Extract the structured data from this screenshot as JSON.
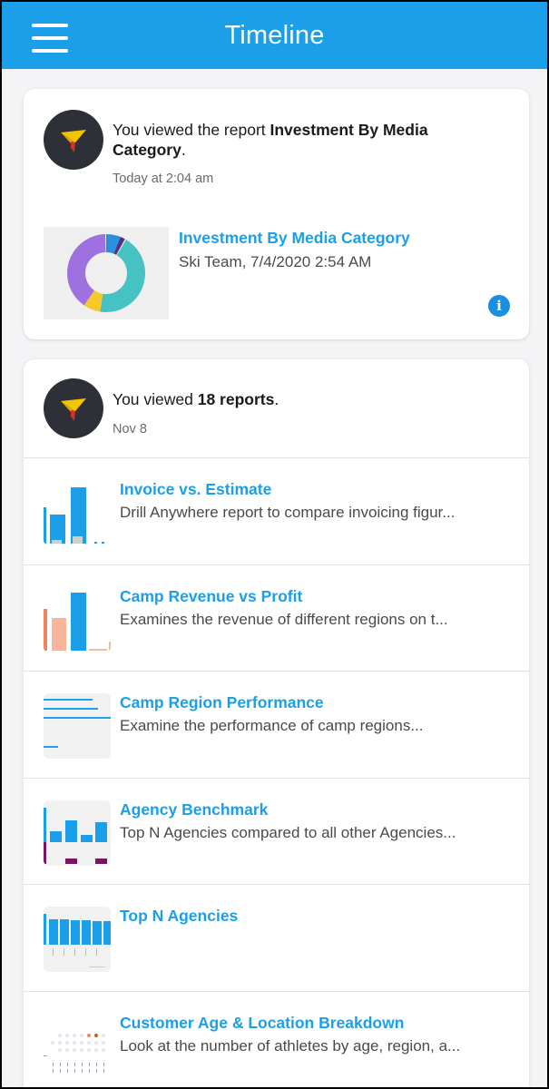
{
  "appbar": {
    "title": "Timeline",
    "menu_icon": "hamburger-menu-icon",
    "color": "#1a9fe8"
  },
  "card1": {
    "prefix": "You viewed the report ",
    "report_bold": "Investment By Media Category",
    "suffix": ".",
    "date": "Today at 2:04 am",
    "report": {
      "title": "Investment By Media Category",
      "subtitle": "Ski Team, 7/4/2020 2:54 AM"
    },
    "info_icon": "i"
  },
  "card2": {
    "prefix": "You viewed ",
    "count_bold": "18 reports",
    "suffix": ".",
    "date": "Nov 8",
    "items": [
      {
        "title": "Invoice vs. Estimate",
        "description": "Drill Anywhere report to compare invoicing figur..."
      },
      {
        "title": "Camp Revenue vs Profit",
        "description": "Examines the revenue of different regions on t..."
      },
      {
        "title": "Camp Region Performance",
        "description": "Examine the performance of camp regions..."
      },
      {
        "title": "Agency Benchmark",
        "description": "Top N Agencies compared to all other Agencies..."
      },
      {
        "title": "Top N Agencies",
        "description": ""
      },
      {
        "title": "Customer Age & Location Breakdown",
        "description": "Look at the number of athletes by age, region, a..."
      }
    ]
  }
}
